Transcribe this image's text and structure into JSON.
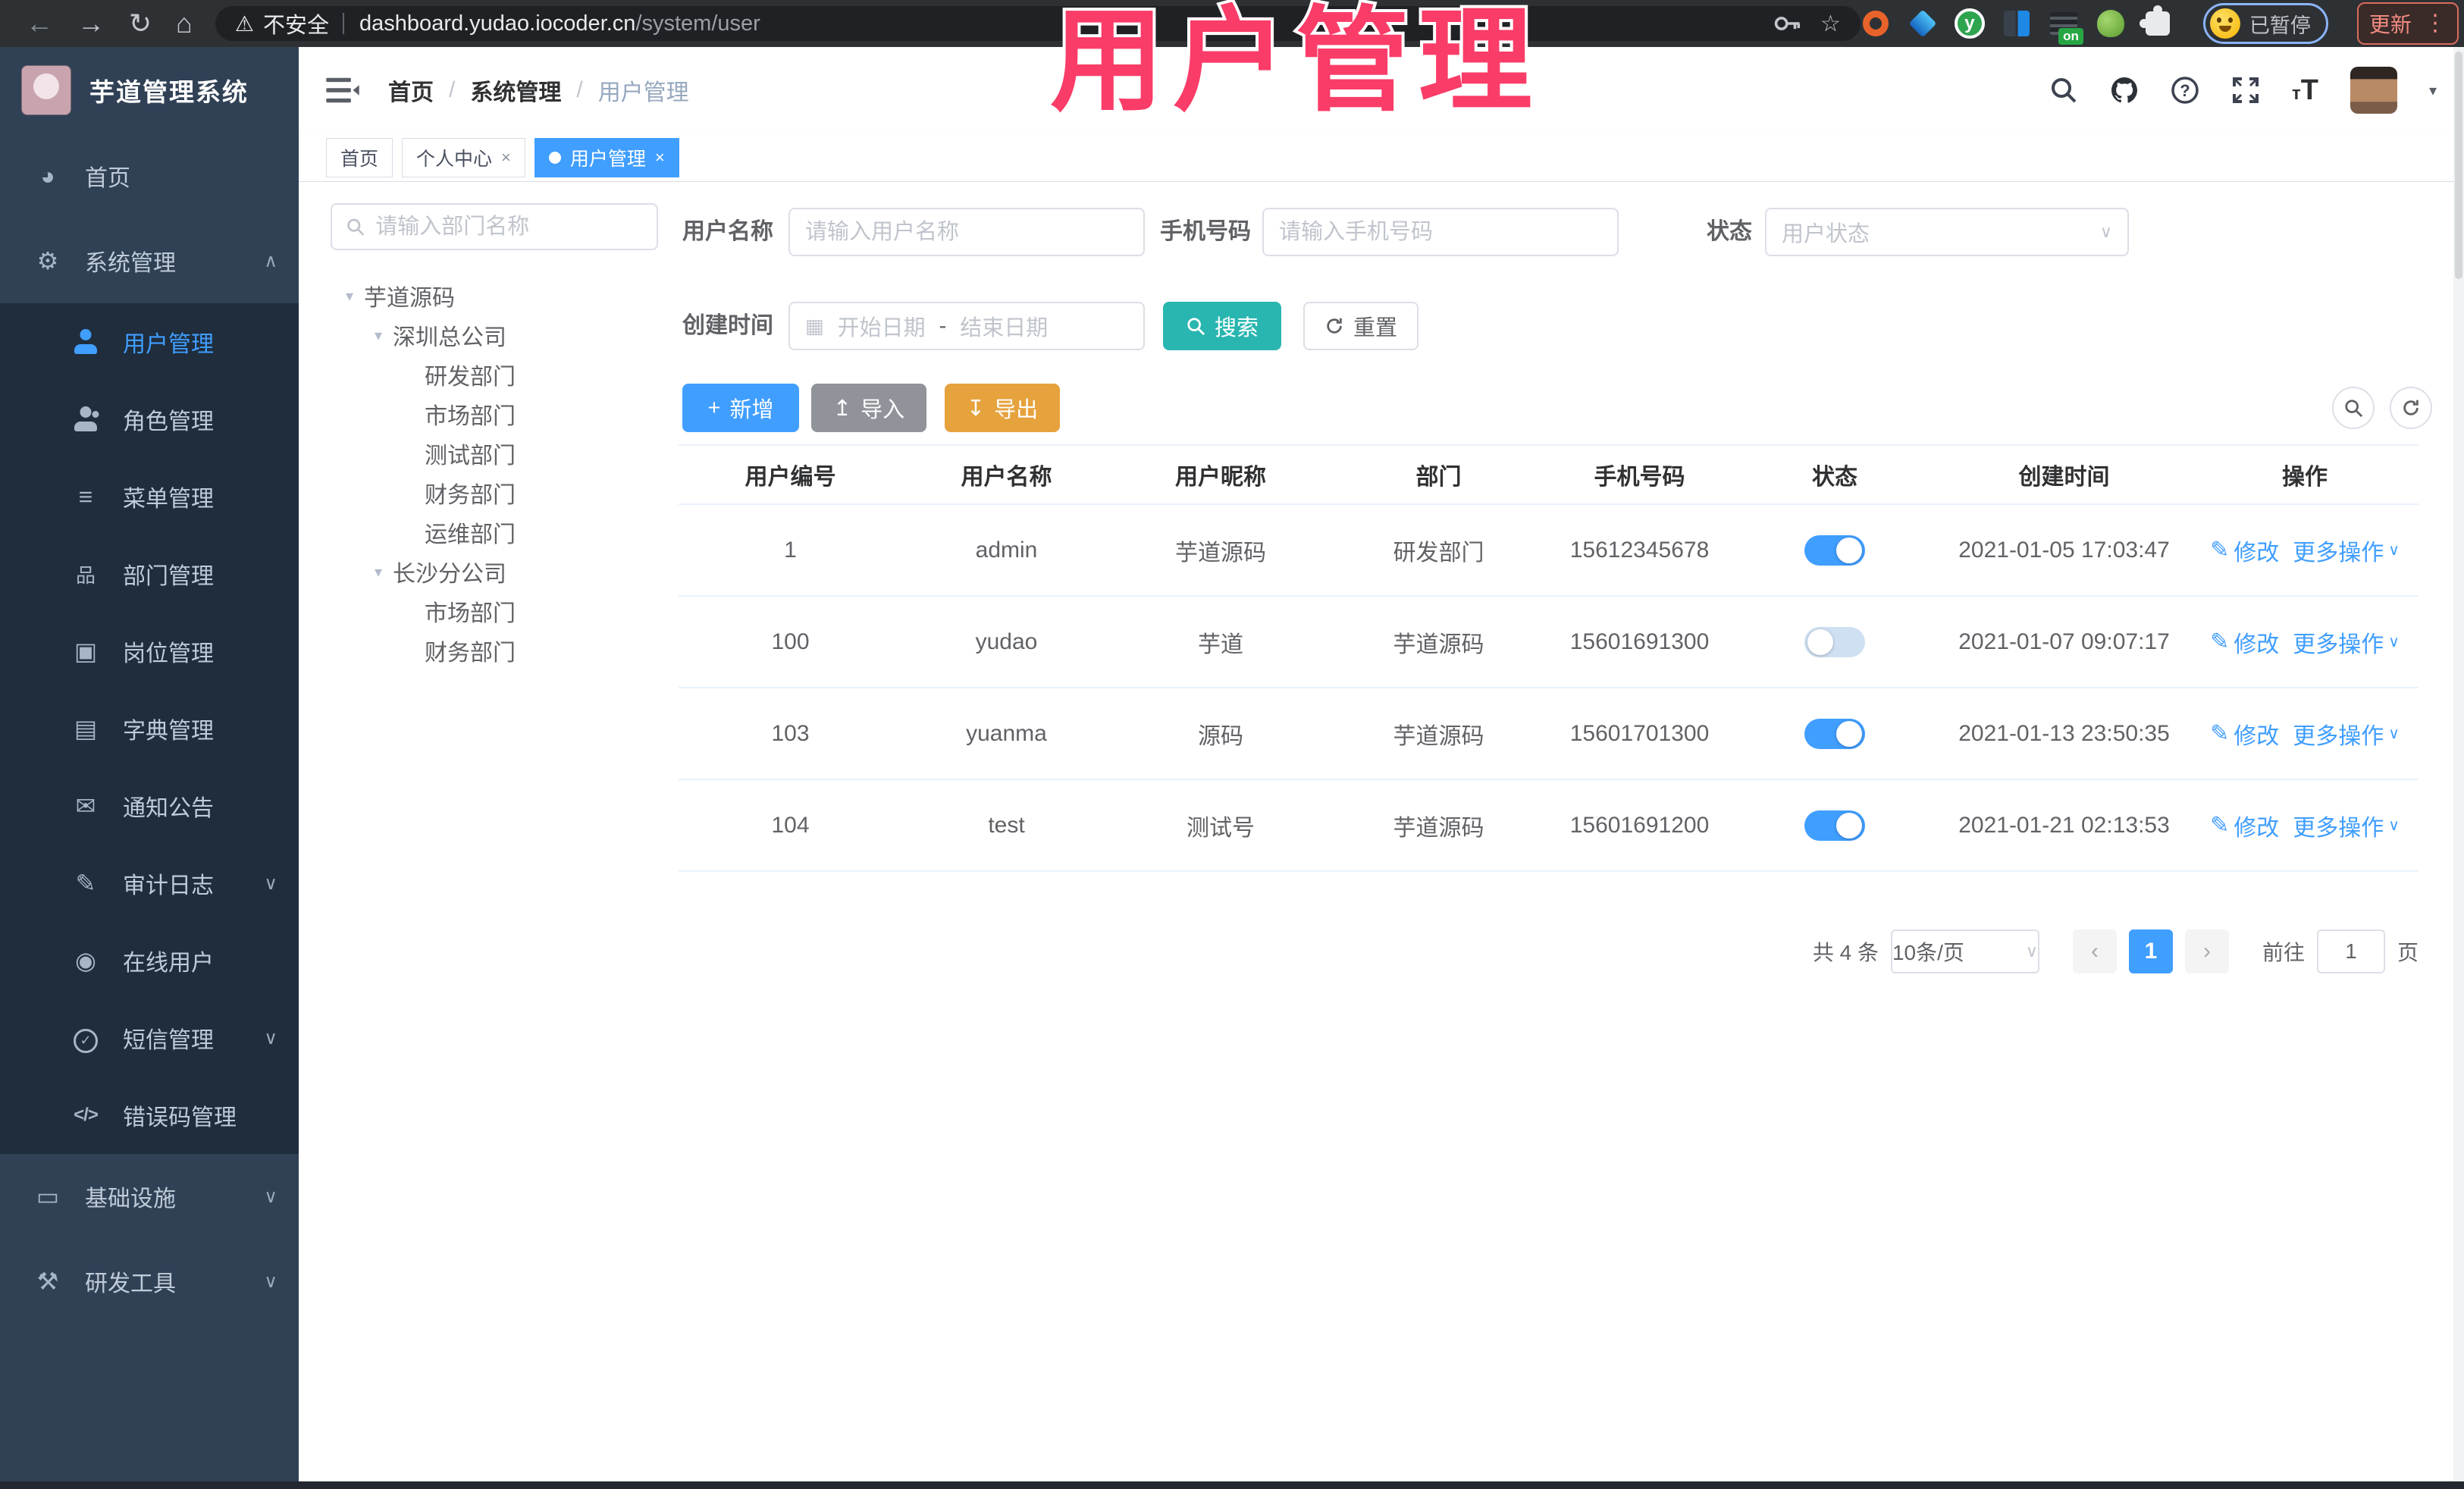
{
  "colors": {
    "primary": "#409eff",
    "teal": "#29b6b0",
    "warning": "#e6a23c",
    "info": "#909399",
    "pink": "#fa3c68",
    "sidebar": "#304156",
    "submenu": "#1f2d3d",
    "sidebartext": "#bfcbd9"
  },
  "browser": {
    "security_label": "不安全",
    "url_host": "dashboard.yudao.iocoder.cn",
    "url_path": "/system/user",
    "extension_badge": "on",
    "profile_status": "已暂停",
    "update_label": "更新"
  },
  "overlay": {
    "title": "用户管理"
  },
  "sidebar": {
    "logo_title": "芋道管理系统",
    "items": [
      {
        "label": "首页"
      },
      {
        "label": "系统管理"
      },
      {
        "label": "用户管理"
      },
      {
        "label": "角色管理"
      },
      {
        "label": "菜单管理"
      },
      {
        "label": "部门管理"
      },
      {
        "label": "岗位管理"
      },
      {
        "label": "字典管理"
      },
      {
        "label": "通知公告"
      },
      {
        "label": "审计日志"
      },
      {
        "label": "在线用户"
      },
      {
        "label": "短信管理"
      },
      {
        "label": "错误码管理"
      },
      {
        "label": "基础设施"
      },
      {
        "label": "研发工具"
      }
    ]
  },
  "breadcrumb": [
    "首页",
    "系统管理",
    "用户管理"
  ],
  "tabs": [
    {
      "label": "首页"
    },
    {
      "label": "个人中心"
    },
    {
      "label": "用户管理"
    }
  ],
  "dept": {
    "search_placeholder": "请输入部门名称",
    "tree": [
      {
        "label": "芋道源码"
      },
      {
        "label": "深圳总公司"
      },
      {
        "label": "研发部门"
      },
      {
        "label": "市场部门"
      },
      {
        "label": "测试部门"
      },
      {
        "label": "财务部门"
      },
      {
        "label": "运维部门"
      },
      {
        "label": "长沙分公司"
      },
      {
        "label": "市场部门"
      },
      {
        "label": "财务部门"
      }
    ]
  },
  "filters": {
    "username_label": "用户名称",
    "username_placeholder": "请输入用户名称",
    "mobile_label": "手机号码",
    "mobile_placeholder": "请输入手机号码",
    "status_label": "状态",
    "status_placeholder": "用户状态",
    "create_time_label": "创建时间",
    "date_start_placeholder": "开始日期",
    "date_separator": "-",
    "date_end_placeholder": "结束日期",
    "search_label": "搜索",
    "reset_label": "重置"
  },
  "toolbar": {
    "add_label": "新增",
    "import_label": "导入",
    "export_label": "导出"
  },
  "table": {
    "columns": [
      "用户编号",
      "用户名称",
      "用户昵称",
      "部门",
      "手机号码",
      "状态",
      "创建时间",
      "操作"
    ],
    "edit_label": "修改",
    "more_label": "更多操作",
    "rows": [
      {
        "id": "1",
        "username": "admin",
        "nickname": "芋道源码",
        "dept": "研发部门",
        "mobile": "15612345678",
        "status": "on",
        "created": "2021-01-05 17:03:47"
      },
      {
        "id": "100",
        "username": "yudao",
        "nickname": "芋道",
        "dept": "芋道源码",
        "mobile": "15601691300",
        "status": "off",
        "created": "2021-01-07 09:07:17"
      },
      {
        "id": "103",
        "username": "yuanma",
        "nickname": "源码",
        "dept": "芋道源码",
        "mobile": "15601701300",
        "status": "on",
        "created": "2021-01-13 23:50:35"
      },
      {
        "id": "104",
        "username": "test",
        "nickname": "测试号",
        "dept": "芋道源码",
        "mobile": "15601691200",
        "status": "on",
        "created": "2021-01-21 02:13:53"
      }
    ]
  },
  "pagination": {
    "total": "共 4 条",
    "page_size": "10条/页",
    "current": "1",
    "goto_label": "前往",
    "goto_value": "1",
    "page_label": "页"
  },
  "icons": {
    "back-icon": "←",
    "forward-icon": "→",
    "reload-icon": "↻",
    "home-icon": "⌂",
    "warning-icon": "⚠",
    "star-icon": "☆",
    "kebab-menu-icon": "⋮",
    "dashboard-icon": "◕",
    "gear-icon": "⚙",
    "menu-icon": "≡",
    "dept-icon": "品",
    "post-icon": "▣",
    "dict-icon": "▤",
    "notice-icon": "✉",
    "audit-icon": "✎",
    "online-icon": "◉",
    "sms-check-icon": "✓",
    "code-icon": "</>",
    "infra-icon": "▭",
    "devtool-icon": "⚒",
    "tree-caret": "▾",
    "calendar-icon": "▦",
    "plus-icon": "+",
    "import-icon": "↥",
    "export-icon": "↧",
    "chevron-up": "∧",
    "chevron-down": "∨"
  }
}
